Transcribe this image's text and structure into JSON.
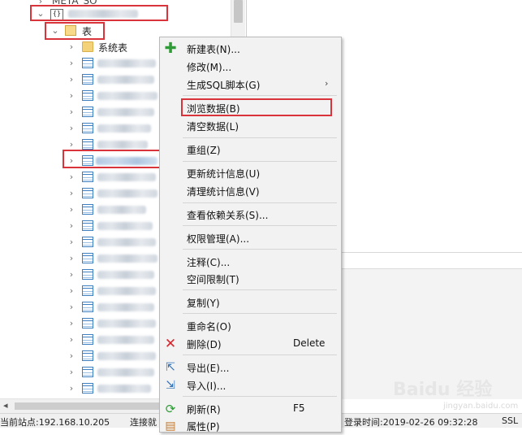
{
  "tree": {
    "top_node": "META_SO",
    "schema_node": "",
    "tables_folder": "表",
    "system_tables": "系统表"
  },
  "menu": {
    "items": [
      {
        "label": "新建表(N)...",
        "icon": "plus-icon"
      },
      {
        "label": "修改(M)..."
      },
      {
        "label": "生成SQL脚本(G)",
        "submenu": "›"
      },
      {
        "label": "浏览数据(B)"
      },
      {
        "label": "清空数据(L)"
      },
      {
        "label": "重组(Z)"
      },
      {
        "label": "更新统计信息(U)"
      },
      {
        "label": "清理统计信息(V)"
      },
      {
        "label": "查看依赖关系(S)..."
      },
      {
        "label": "权限管理(A)..."
      },
      {
        "label": "注释(C)..."
      },
      {
        "label": "空间限制(T)"
      },
      {
        "label": "复制(Y)"
      },
      {
        "label": "重命名(O)"
      },
      {
        "label": "删除(D)",
        "shortcut": "Delete",
        "icon": "delete-x-icon"
      },
      {
        "label": "导出(E)...",
        "icon": "export-icon"
      },
      {
        "label": "导入(I)...",
        "icon": "import-icon"
      },
      {
        "label": "刷新(R)",
        "shortcut": "F5",
        "icon": "refresh-icon"
      },
      {
        "label": "属性(P)",
        "icon": "properties-icon"
      }
    ]
  },
  "statusbar": {
    "node": "当前站点:192.168.10.205",
    "connect": "连接就",
    "login_time": "登录时间:2019-02-26 09:32:28",
    "ssl": "SSL"
  },
  "watermark": {
    "text": "Baidu 经验",
    "sub": "jingyan.baidu.com"
  },
  "colors": {
    "highlight_box": "#d9333b",
    "menu_bg": "#f2f2f2",
    "table_icon": "#3d7fc1"
  }
}
